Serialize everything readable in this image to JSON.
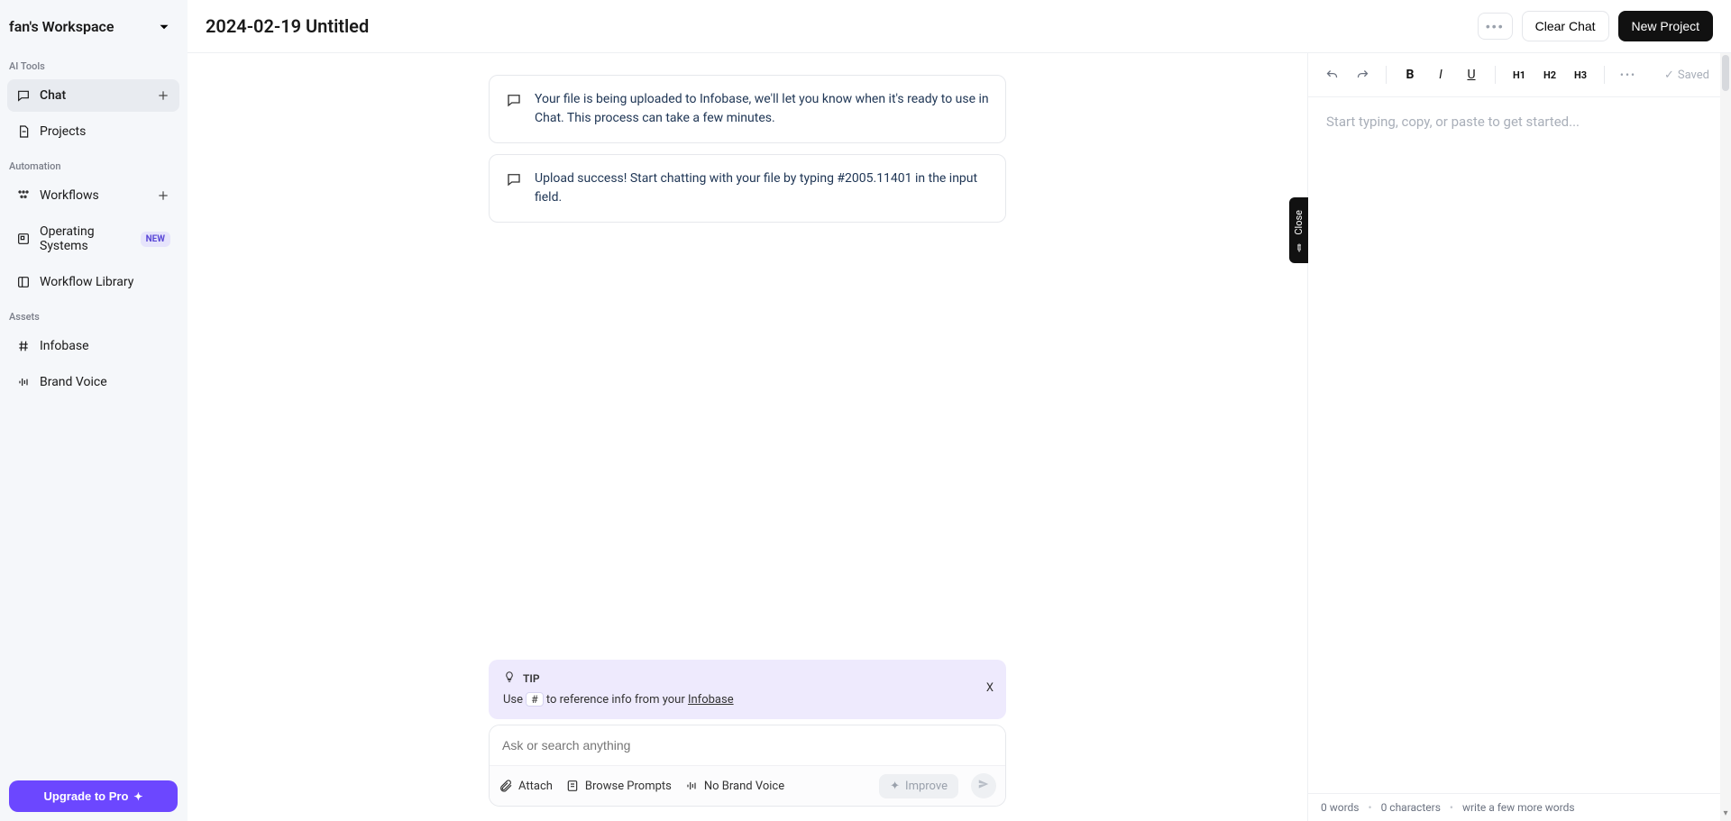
{
  "workspace": {
    "name": "fan's Workspace"
  },
  "sidebar": {
    "sections": {
      "ai_tools": "AI Tools",
      "automation": "Automation",
      "assets": "Assets"
    },
    "chat": "Chat",
    "projects": "Projects",
    "workflows": "Workflows",
    "operating_systems": "Operating Systems",
    "new_badge": "NEW",
    "workflow_library": "Workflow Library",
    "infobase": "Infobase",
    "brand_voice": "Brand Voice",
    "upgrade": "Upgrade to Pro"
  },
  "header": {
    "title": "2024-02-19 Untitled",
    "clear_chat": "Clear Chat",
    "new_project": "New Project"
  },
  "messages": [
    {
      "text": "Your file is being uploaded to Infobase, we'll let you know when it's ready to use in Chat. This process can take a few minutes."
    },
    {
      "text": "Upload success! Start chatting with your file by typing #2005.11401 in the input field."
    }
  ],
  "tip": {
    "label": "TIP",
    "pre": "Use ",
    "key": "#",
    "mid": " to reference info from your ",
    "link": "Infobase",
    "close": "X"
  },
  "chat_input": {
    "placeholder": "Ask or search anything",
    "attach": "Attach",
    "browse_prompts": "Browse Prompts",
    "no_brand_voice": "No Brand Voice",
    "improve": "Improve"
  },
  "close_tab": "Close",
  "editor": {
    "h1": "H1",
    "h2": "H2",
    "h3": "H3",
    "bold": "B",
    "italic": "I",
    "underline": "U",
    "saved": "Saved",
    "placeholder": "Start typing, copy, or paste to get started...",
    "words": "0 words",
    "characters": "0 characters",
    "hint": "write a few more words"
  }
}
